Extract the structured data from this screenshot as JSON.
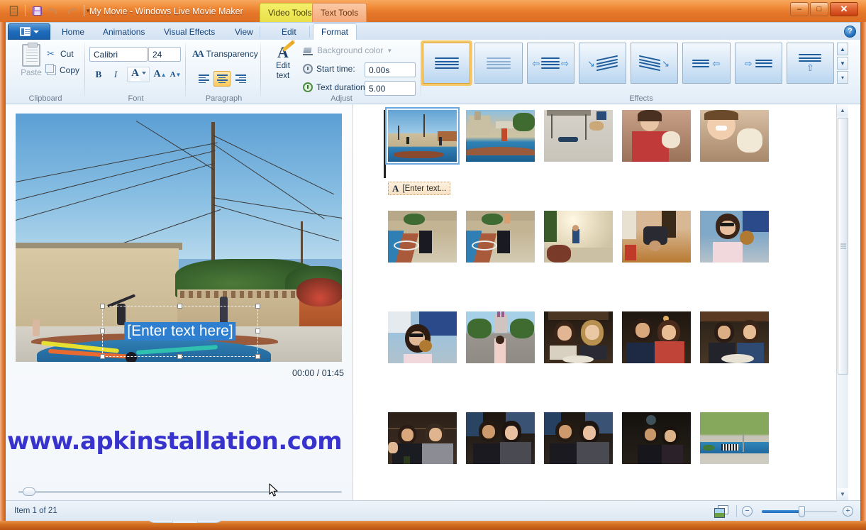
{
  "window": {
    "title": "My Movie - Windows Live Movie Maker",
    "minimize_label": "–",
    "maximize_label": "□",
    "close_label": "✕"
  },
  "quick_access": {
    "app_icon": "filmstrip-icon",
    "save_label": "💾",
    "undo_label": "↶",
    "redo_label": "↷",
    "customize_label": "▾"
  },
  "contextual_tabs": [
    {
      "label": "Video Tools",
      "color": "#f0ea5a"
    },
    {
      "label": "Text Tools",
      "color": "#f7b388"
    }
  ],
  "ribbon_tabs": {
    "app_menu_label": "▾",
    "items": [
      {
        "label": "Home",
        "active": false
      },
      {
        "label": "Animations",
        "active": false
      },
      {
        "label": "Visual Effects",
        "active": false
      },
      {
        "label": "View",
        "active": false
      },
      {
        "label": "Edit",
        "active": false
      },
      {
        "label": "Format",
        "active": true
      }
    ],
    "help_label": "?"
  },
  "ribbon": {
    "clipboard": {
      "group_label": "Clipboard",
      "paste_label": "Paste",
      "cut_label": "Cut",
      "copy_label": "Copy"
    },
    "font": {
      "group_label": "Font",
      "family_value": "Calibri",
      "size_value": "24",
      "bold_label": "B",
      "italic_label": "I",
      "font_color_label": "A",
      "grow_label": "A",
      "shrink_label": "A"
    },
    "paragraph": {
      "group_label": "Paragraph",
      "transparency_label": "Transparency",
      "align_left_label": "align-left",
      "align_center_label": "align-center",
      "align_right_label": "align-right",
      "active_alignment": "center"
    },
    "adjust": {
      "group_label": "Adjust",
      "edit_text_label": "Edit\ntext",
      "edit_text_line1": "Edit",
      "edit_text_line2": "text",
      "background_color_label": "Background color",
      "start_time_label": "Start time:",
      "start_time_value": "0.00s",
      "text_duration_label": "Text duration:",
      "text_duration_value": "5.00"
    },
    "effects": {
      "group_label": "Effects",
      "items": [
        {
          "name": "no-effect",
          "selected": true,
          "arrow": "none",
          "skew": false
        },
        {
          "name": "fade-effect",
          "selected": false,
          "arrow": "none",
          "skew": false,
          "faded": true
        },
        {
          "name": "fly-in-out",
          "selected": false,
          "arrow": "both",
          "skew": false
        },
        {
          "name": "zoom-in-diagonal",
          "selected": false,
          "arrow": "left",
          "skew": true
        },
        {
          "name": "zoom-out-diagonal",
          "selected": false,
          "arrow": "right",
          "skew": true
        },
        {
          "name": "fly-in-left",
          "selected": false,
          "arrow": "after",
          "skew": false
        },
        {
          "name": "fly-in-right",
          "selected": false,
          "arrow": "before",
          "skew": false
        },
        {
          "name": "scroll-up",
          "selected": false,
          "arrow": "up",
          "skew": false
        }
      ],
      "scroll_up_label": "▲",
      "scroll_down_label": "▼",
      "more_label": "▾"
    }
  },
  "preview": {
    "overlay_text": "[Enter text here]",
    "current_time": "00:00",
    "total_time": "01:45",
    "time_readout": "00:00 / 01:45",
    "previous_frame_label": "previous-frame",
    "play_label": "play",
    "next_frame_label": "next-frame"
  },
  "watermark": {
    "text": "www.apkinstallation.com"
  },
  "storyboard": {
    "selected_index": 0,
    "caption_icon_label": "A",
    "caption_text": "[Enter text...",
    "rows": [
      {
        "items": [
          {
            "name": "clip-backyard-jump",
            "sky": "#6aa8d8",
            "ground": "#cbbf9c",
            "accent": "#2b6f9e"
          },
          {
            "name": "clip-pool-house",
            "sky": "#7ab4dc",
            "ground": "#cfc4a4",
            "accent": "#2f82b6"
          },
          {
            "name": "clip-dog-patio",
            "sky": "#c9c6bd",
            "ground": "#d8d5cc",
            "accent": "#8a7a62"
          },
          {
            "name": "clip-woman-dog-1",
            "sky": "#b8907a",
            "ground": "#8e6a52",
            "accent": "#c24a4a"
          },
          {
            "name": "clip-woman-dog-2",
            "sky": "#d0b49a",
            "ground": "#a08468",
            "accent": "#d8d0c4"
          }
        ]
      },
      {
        "items": [
          {
            "name": "clip-poolside-sit-1",
            "sky": "#b9ad8c",
            "ground": "#cdbfa0",
            "accent": "#2f7fb5"
          },
          {
            "name": "clip-poolside-sit-2",
            "sky": "#b9ad8c",
            "ground": "#cdbfa0",
            "accent": "#2f7fb5"
          },
          {
            "name": "clip-sunflare-yard",
            "sky": "#e8ddc8",
            "ground": "#d5c9ae",
            "accent": "#c9a060"
          },
          {
            "name": "clip-living-room",
            "sky": "#c08a4a",
            "ground": "#a8702f",
            "accent": "#3a3a44"
          },
          {
            "name": "clip-woman-pretzel",
            "sky": "#6d9ec4",
            "ground": "#b9c4cc",
            "accent": "#3a2a24"
          }
        ]
      },
      {
        "items": [
          {
            "name": "clip-woman-eating",
            "sky": "#8fb6d4",
            "ground": "#b4c6d2",
            "accent": "#2a3a4a"
          },
          {
            "name": "clip-disneyland",
            "sky": "#9cc6e4",
            "ground": "#9a9a96",
            "accent": "#4d7a3a"
          },
          {
            "name": "clip-two-women-dine",
            "sky": "#2a1e16",
            "ground": "#4a3a2a",
            "accent": "#e0d6c4"
          },
          {
            "name": "clip-couple-dine-1",
            "sky": "#1e1812",
            "ground": "#3a2e24",
            "accent": "#c86a5a"
          },
          {
            "name": "clip-couple-dine-2",
            "sky": "#241c14",
            "ground": "#453626",
            "accent": "#d8c8a8"
          }
        ]
      },
      {
        "items": [
          {
            "name": "clip-two-men-bar",
            "sky": "#241a12",
            "ground": "#3a2c20",
            "accent": "#8a8a90"
          },
          {
            "name": "clip-couple-bar-1",
            "sky": "#1c1610",
            "ground": "#2e2620",
            "accent": "#4a6a8a"
          },
          {
            "name": "clip-couple-bar-2",
            "sky": "#1c1610",
            "ground": "#2e2620",
            "accent": "#4a6a8a"
          },
          {
            "name": "clip-couple-bar-3",
            "sky": "#16120e",
            "ground": "#26201a",
            "accent": "#3a3a44"
          },
          {
            "name": "clip-pool-sign",
            "sky": "#7a9a52",
            "ground": "#c4c0b4",
            "accent": "#2f7fb5"
          }
        ]
      }
    ],
    "scroll_up_label": "▲",
    "scroll_down_label": "▼"
  },
  "statusbar": {
    "item_status": "Item 1 of 21",
    "view_toggle_label": "view-toggle",
    "zoom_out_label": "−",
    "zoom_in_label": "+",
    "zoom_value": 50
  },
  "colors": {
    "frame_orange": "#d96a22",
    "ribbon_blue": "#e1ecf7",
    "accent_blue": "#1f6cbb",
    "selection_gold": "#f5c96a",
    "watermark_blue": "#3733cc"
  }
}
